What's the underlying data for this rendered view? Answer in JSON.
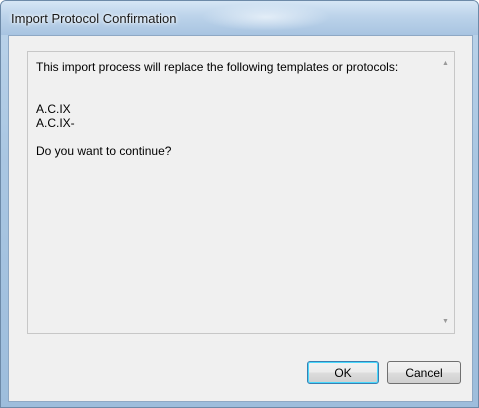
{
  "dialog": {
    "title": "Import Protocol Confirmation"
  },
  "message": {
    "intro": "This import process will replace the following templates or protocols:",
    "items": [
      "A.C.IX",
      "A.C.IX-"
    ],
    "question": "Do you want to continue?"
  },
  "scrollbar": {
    "up_icon": "scroll-up-arrow",
    "down_icon": "scroll-down-arrow"
  },
  "buttons": {
    "ok_label": "OK",
    "cancel_label": "Cancel"
  }
}
